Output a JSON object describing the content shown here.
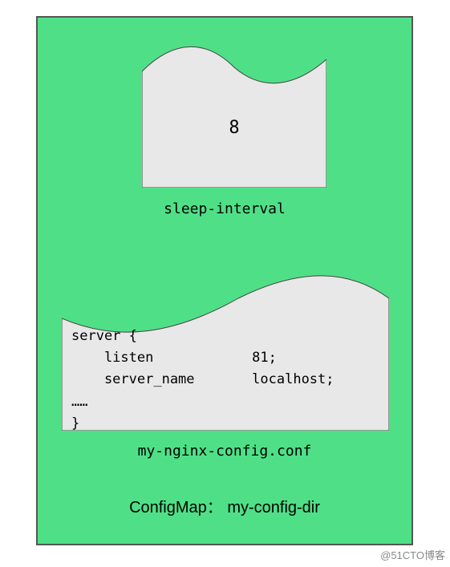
{
  "configmap": {
    "title": "ConfigMap： my-config-dir",
    "entries": [
      {
        "key": "sleep-interval",
        "value": "8"
      },
      {
        "key": "my-nginx-config.conf",
        "value": "server {\n    listen            81;\n    server_name       localhost;\n……\n}"
      }
    ]
  },
  "watermark": "@51CTO博客"
}
